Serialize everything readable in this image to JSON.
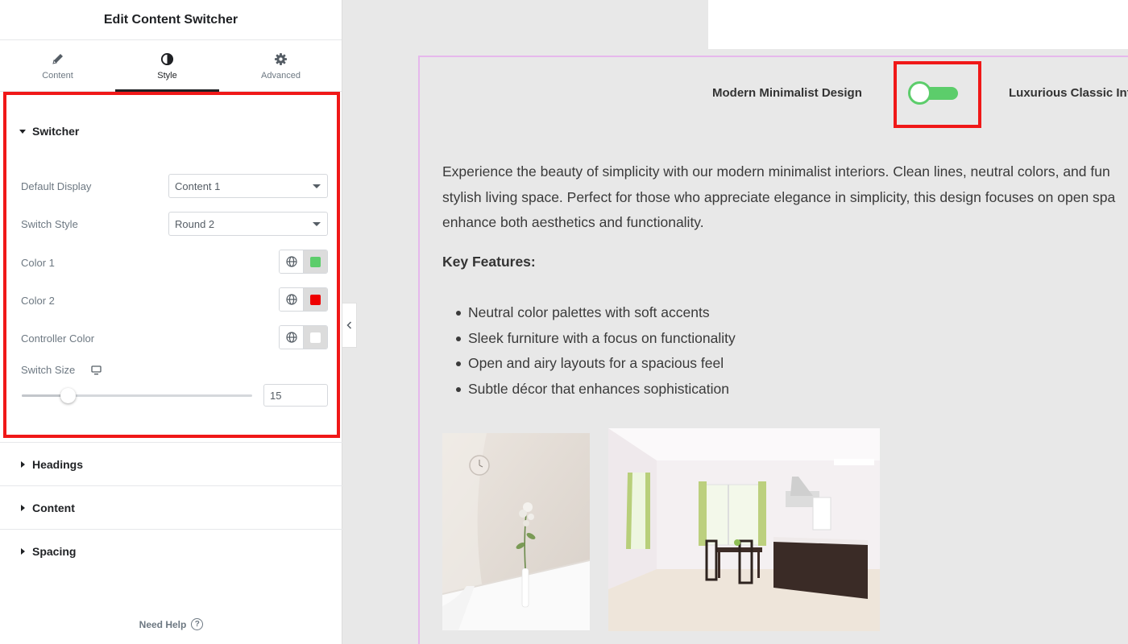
{
  "panel": {
    "title": "Edit Content Switcher",
    "tabs": [
      {
        "label": "Content",
        "icon": "pencil-icon"
      },
      {
        "label": "Style",
        "icon": "contrast-icon",
        "active": true
      },
      {
        "label": "Advanced",
        "icon": "gear-icon"
      }
    ],
    "switcher_section": {
      "title": "Switcher",
      "default_display": {
        "label": "Default Display",
        "value": "Content 1"
      },
      "switch_style": {
        "label": "Switch Style",
        "value": "Round 2"
      },
      "color1": {
        "label": "Color 1",
        "swatch": "#5ccd6b"
      },
      "color2": {
        "label": "Color 2",
        "swatch": "#ee0000"
      },
      "controller_color": {
        "label": "Controller Color",
        "swatch": "#ffffff"
      },
      "switch_size": {
        "label": "Switch Size",
        "value": "15",
        "device_icon": "desktop-icon",
        "slider_fraction": 0.2
      }
    },
    "collapsed_sections": [
      "Headings",
      "Content",
      "Spacing"
    ],
    "need_help": "Need Help"
  },
  "preview": {
    "switch_label_1": "Modern Minimalist Design",
    "switch_label_2": "Luxurious Classic Int",
    "toggle": {
      "track_color": "#5ccd6b",
      "state": "content-1"
    },
    "paragraph_lines": [
      "Experience the beauty of simplicity with our modern minimalist interiors. Clean lines, neutral colors, and fun",
      "stylish living space. Perfect for those who appreciate elegance in simplicity, this design focuses on open spa",
      "enhance both aesthetics and functionality."
    ],
    "key_features_heading": "Key Features:",
    "features": [
      "Neutral color palettes with soft accents",
      "Sleek furniture with a focus on functionality",
      "Open and airy layouts for a spacious feel",
      "Subtle décor that enhances sophistication"
    ]
  },
  "colors": {
    "highlight": "#f01818",
    "toggle_green": "#5ccd6b",
    "preview_border": "#e6b8ec"
  }
}
